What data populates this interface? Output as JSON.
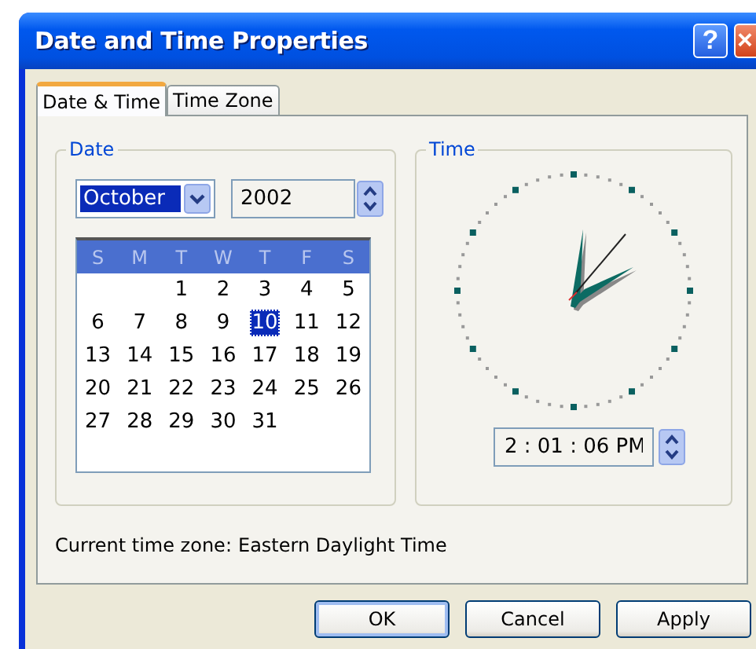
{
  "window": {
    "title": "Date and Time Properties",
    "help_button": "?",
    "close_button": "×"
  },
  "tabs": [
    {
      "label": "Date & Time",
      "selected": true
    },
    {
      "label": "Time Zone",
      "selected": false
    }
  ],
  "date_group": {
    "title": "Date",
    "month": "October",
    "year": "2002",
    "weekdays": [
      "S",
      "M",
      "T",
      "W",
      "T",
      "F",
      "S"
    ],
    "weeks": [
      [
        {
          "day": "1",
          "selected": false
        },
        {
          "day": "2",
          "selected": false
        },
        {
          "day": "3",
          "selected": false
        },
        {
          "day": "4",
          "selected": false
        },
        {
          "day": "5",
          "selected": false
        }
      ],
      [
        {
          "day": "6",
          "selected": false
        },
        {
          "day": "7",
          "selected": false
        },
        {
          "day": "8",
          "selected": false
        },
        {
          "day": "9",
          "selected": false
        },
        {
          "day": "10",
          "selected": true
        },
        {
          "day": "11",
          "selected": false
        },
        {
          "day": "12",
          "selected": false
        }
      ],
      [
        {
          "day": "13",
          "selected": false
        },
        {
          "day": "14",
          "selected": false
        },
        {
          "day": "15",
          "selected": false
        },
        {
          "day": "16",
          "selected": false
        },
        {
          "day": "17",
          "selected": false
        },
        {
          "day": "18",
          "selected": false
        },
        {
          "day": "19",
          "selected": false
        }
      ],
      [
        {
          "day": "20",
          "selected": false
        },
        {
          "day": "21",
          "selected": false
        },
        {
          "day": "22",
          "selected": false
        },
        {
          "day": "23",
          "selected": false
        },
        {
          "day": "24",
          "selected": false
        },
        {
          "day": "25",
          "selected": false
        },
        {
          "day": "26",
          "selected": false
        }
      ],
      [
        {
          "day": "27",
          "selected": false
        },
        {
          "day": "28",
          "selected": false
        },
        {
          "day": "29",
          "selected": false
        },
        {
          "day": "30",
          "selected": false
        },
        {
          "day": "31",
          "selected": false
        }
      ]
    ]
  },
  "time_group": {
    "title": "Time",
    "time": "2 : 01 : 06 PM"
  },
  "time_zone": {
    "label": "Current time zone:",
    "value": "Eastern Daylight Time"
  },
  "buttons": [
    {
      "label": "OK",
      "default": true
    },
    {
      "label": "Cancel",
      "default": false
    },
    {
      "label": "Apply",
      "default": false
    }
  ]
}
